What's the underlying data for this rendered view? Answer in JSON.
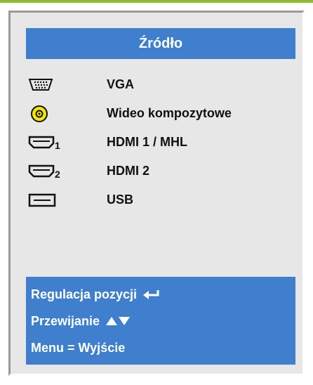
{
  "menu": {
    "title": "Źródło",
    "sources": [
      {
        "label": "VGA",
        "icon": "vga-icon"
      },
      {
        "label": "Wideo kompozytowe",
        "icon": "composite-video-icon"
      },
      {
        "label": "HDMI 1 / MHL",
        "icon": "hdmi-1-icon"
      },
      {
        "label": "HDMI 2",
        "icon": "hdmi-2-icon"
      },
      {
        "label": "USB",
        "icon": "usb-icon"
      }
    ]
  },
  "footer": {
    "position_adjust_label": "Regulacja pozycji",
    "scroll_label": "Przewijanie",
    "exit_label": "Menu = Wyjście"
  },
  "colors": {
    "accent_blue": "#3f7fcd",
    "panel_gray": "#e7e7e7",
    "top_bar_green": "#8dbb2f",
    "composite_yellow": "#f5e600"
  }
}
